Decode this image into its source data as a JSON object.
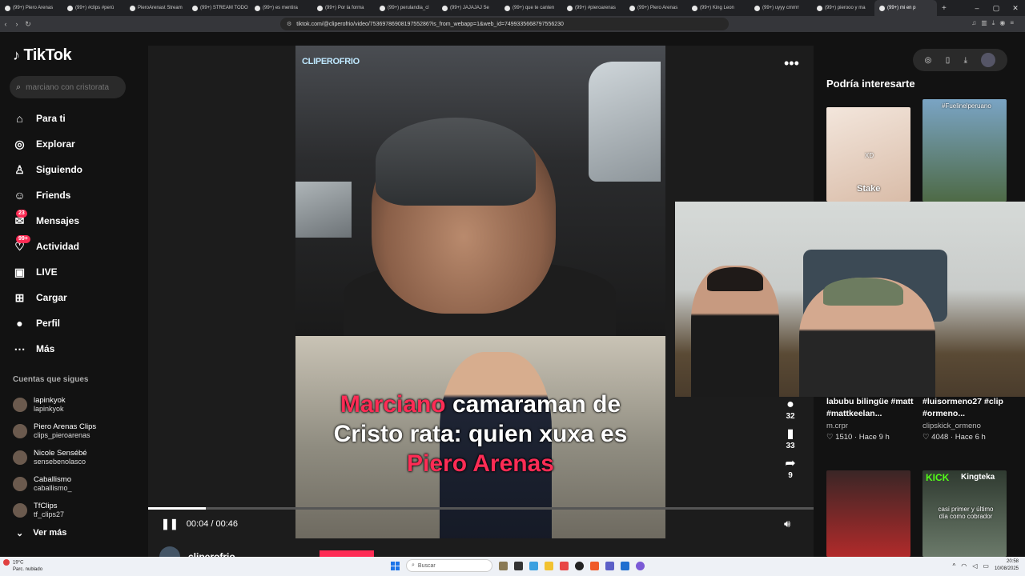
{
  "browser": {
    "tabs": [
      {
        "label": "(99+) Piero Arenas"
      },
      {
        "label": "(99+) #clips #perú"
      },
      {
        "label": "PieroArenast Stream"
      },
      {
        "label": "(99+) STREAM TODO"
      },
      {
        "label": "(99+) es mentira"
      },
      {
        "label": "(99+) Por la forma"
      },
      {
        "label": "(99+) perulandia_cl"
      },
      {
        "label": "(99+) JAJAJAJ Se"
      },
      {
        "label": "(99+) que te canten"
      },
      {
        "label": "(99+) #pieroarenas"
      },
      {
        "label": "(99+) Piero Arenas"
      },
      {
        "label": "(99+) King Leon"
      },
      {
        "label": "(99+) uyyy cmrrrr"
      },
      {
        "label": "(99+) pierooo y ma"
      },
      {
        "label": "(99+) mi en p"
      }
    ],
    "new_tab": "+",
    "window_controls": {
      "minimize": "–",
      "maximize": "▢",
      "close": "✕"
    },
    "url": "tiktok.com/@cliperofrio/video/7536978690819755286?is_from_webapp=1&web_id=7499335668797556230"
  },
  "sidebar": {
    "logo_text": "TikTok",
    "search_placeholder": "marciano con cristorata",
    "nav": [
      {
        "label": "Para ti",
        "icon": "home-icon"
      },
      {
        "label": "Explorar",
        "icon": "compass-icon"
      },
      {
        "label": "Siguiendo",
        "icon": "user-follow-icon"
      },
      {
        "label": "Friends",
        "icon": "friends-icon"
      },
      {
        "label": "Mensajes",
        "icon": "message-icon",
        "badge": "23"
      },
      {
        "label": "Actividad",
        "icon": "activity-icon",
        "badge": "99+"
      },
      {
        "label": "LIVE",
        "icon": "live-icon"
      },
      {
        "label": "Cargar",
        "icon": "upload-icon"
      },
      {
        "label": "Perfil",
        "icon": "profile-icon"
      },
      {
        "label": "Más",
        "icon": "more-icon"
      }
    ],
    "following_title": "Cuentas que sigues",
    "following": [
      {
        "name": "lapinkyok",
        "handle": "lapinkyok"
      },
      {
        "name": "Piero Arenas Clips",
        "handle": "clips_pieroarenas"
      },
      {
        "name": "Nicole Sensébé",
        "handle": "sensebenolasco"
      },
      {
        "name": "Caballismo",
        "handle": "caballismo_"
      },
      {
        "name": "TfClips",
        "handle": "tf_clips27"
      }
    ],
    "see_more": "Ver más"
  },
  "video": {
    "channel_logo": "CLIPEROFRIO",
    "caption_line1_pink": "Marciano",
    "caption_line1_rest": " camaraman de",
    "caption_line2": "Cristo rata: quien xuxa es",
    "caption_line3_pink": "Piero Arenas",
    "time": "00:04 / 00:46",
    "progress": 0.087,
    "actions": [
      {
        "icon": "comment-icon",
        "count": "32"
      },
      {
        "icon": "bookmark-icon",
        "count": "33"
      },
      {
        "icon": "share-icon",
        "count": "9"
      }
    ],
    "author": "cliperofrio"
  },
  "recommendations": {
    "title": "Podría interesarte",
    "thumb_labels": {
      "t1_top": "XD",
      "t1_bottom": "Stake",
      "t2_top": "#Fuelinelperuano",
      "t4_brand": "KICK",
      "t4_name": "Kingteka",
      "t4_caption": "casi primer y último día como cobrador"
    },
    "items": [
      {
        "title": "labubu bilingüe #matt #mattkeelan...",
        "author": "m.crpr",
        "likes": "1510",
        "age": "Hace 9 h"
      },
      {
        "title": "#luisormeno27 #clip #ormeno...",
        "author": "clipskick_ormeno",
        "likes": "4048",
        "age": "Hace 6 h"
      }
    ]
  },
  "taskbar": {
    "weather_temp": "19°C",
    "weather_desc": "Parc. nublado",
    "search_label": "Buscar",
    "time": "20:58",
    "date": "10/08/2025"
  },
  "colors": {
    "accent": "#fe2c55",
    "bg": "#121212"
  }
}
